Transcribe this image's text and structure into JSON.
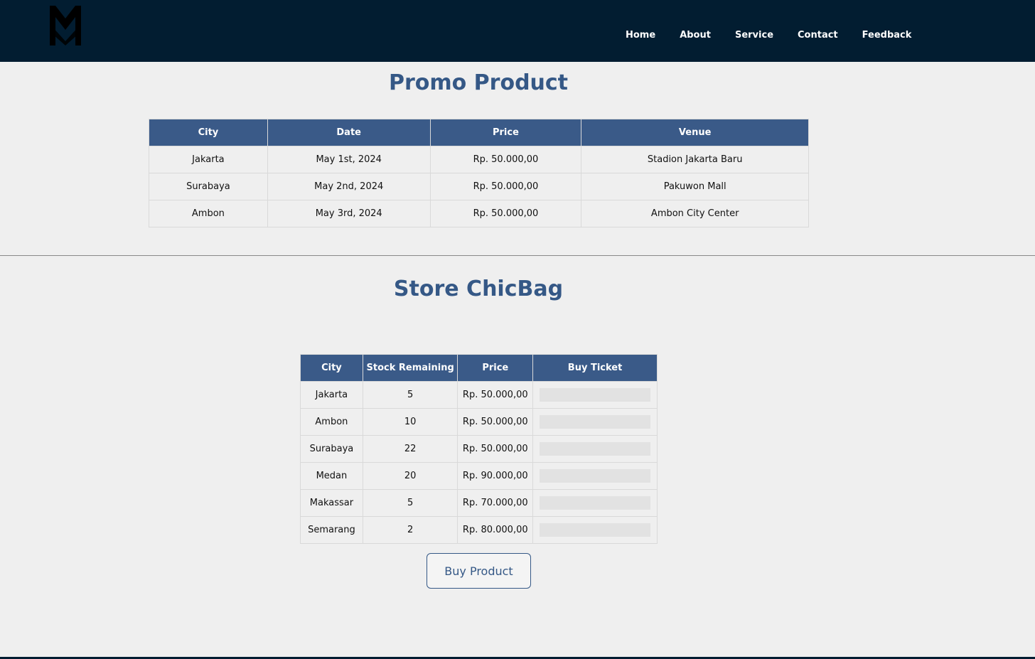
{
  "nav": {
    "links": [
      "Home",
      "About",
      "Service",
      "Contact",
      "Feedback"
    ]
  },
  "promo": {
    "title": "Promo Product",
    "headers": [
      "City",
      "Date",
      "Price",
      "Venue"
    ],
    "rows": [
      [
        "Jakarta",
        "May 1st, 2024",
        "Rp. 50.000,00",
        "Stadion Jakarta Baru"
      ],
      [
        "Surabaya",
        "May 2nd, 2024",
        "Rp. 50.000,00",
        "Pakuwon Mall"
      ],
      [
        "Ambon",
        "May 3rd, 2024",
        "Rp. 50.000,00",
        "Ambon City Center"
      ]
    ]
  },
  "store": {
    "title": "Store ChicBag",
    "headers": [
      "City",
      "Stock Remaining",
      "Price",
      "Buy Ticket"
    ],
    "rows": [
      [
        "Jakarta",
        "5",
        "Rp. 50.000,00"
      ],
      [
        "Ambon",
        "10",
        "Rp. 50.000,00"
      ],
      [
        "Surabaya",
        "22",
        "Rp. 50.000,00"
      ],
      [
        "Medan",
        "20",
        "Rp. 90.000,00"
      ],
      [
        "Makassar",
        "5",
        "Rp. 70.000,00"
      ],
      [
        "Semarang",
        "2",
        "Rp. 80.000,00"
      ]
    ],
    "buy_button_label": "Buy Product"
  },
  "colors": {
    "navbar": "#021d31",
    "accent": "#355886",
    "table_header": "#3a5a88",
    "background": "#efefef"
  }
}
